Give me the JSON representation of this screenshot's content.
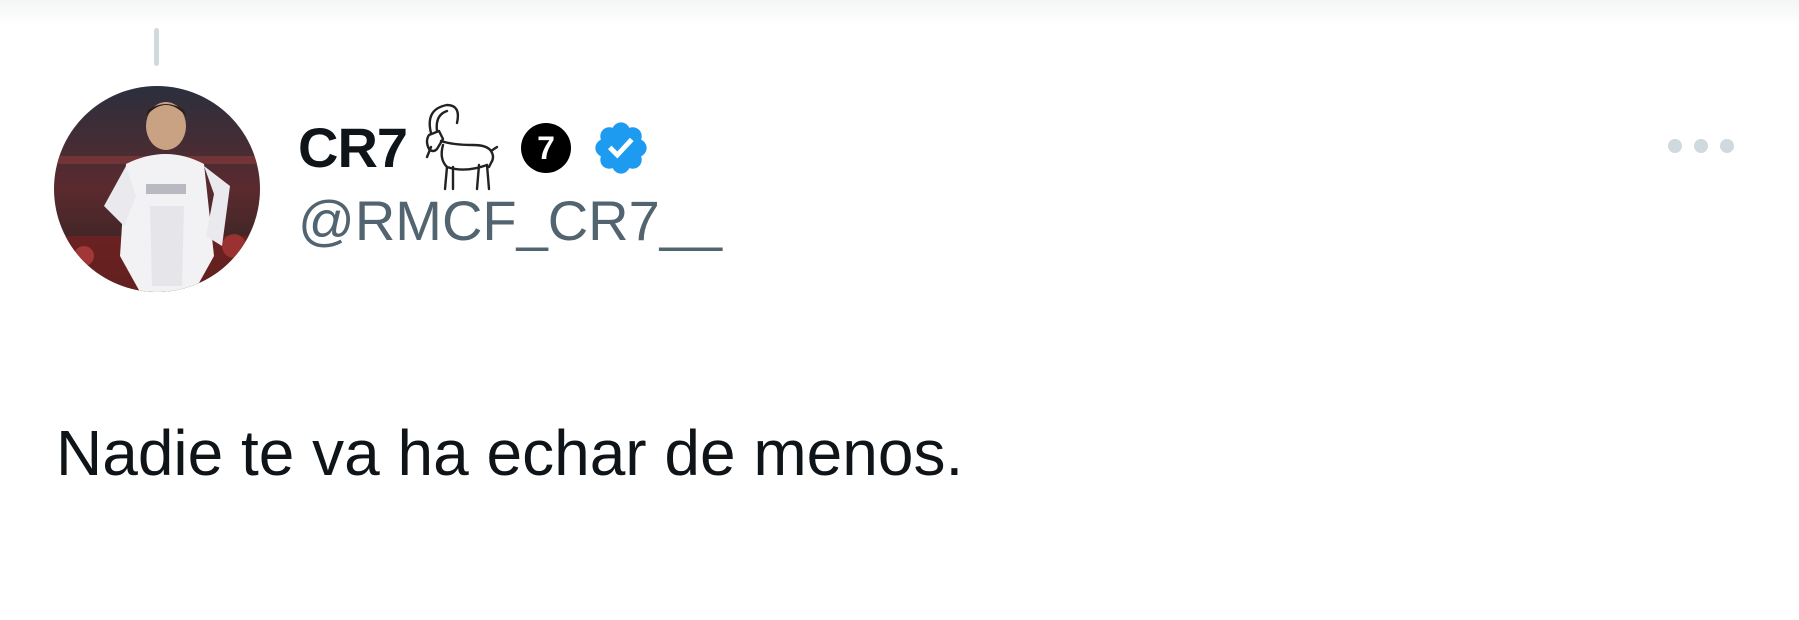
{
  "tweet": {
    "author": {
      "display_name": "CR7",
      "handle": "@RMCF_CR7__",
      "name_emoji_icon": "goat-icon",
      "number_badge": "7",
      "verified_icon": "verified-badge-icon",
      "verified_color": "#1d9bf0"
    },
    "more_options_icon": "more-horizontal-icon",
    "text": "Nadie te va ha echar de menos."
  },
  "colors": {
    "text_primary": "#0f1419",
    "text_secondary": "#536471",
    "accent": "#1d9bf0"
  }
}
